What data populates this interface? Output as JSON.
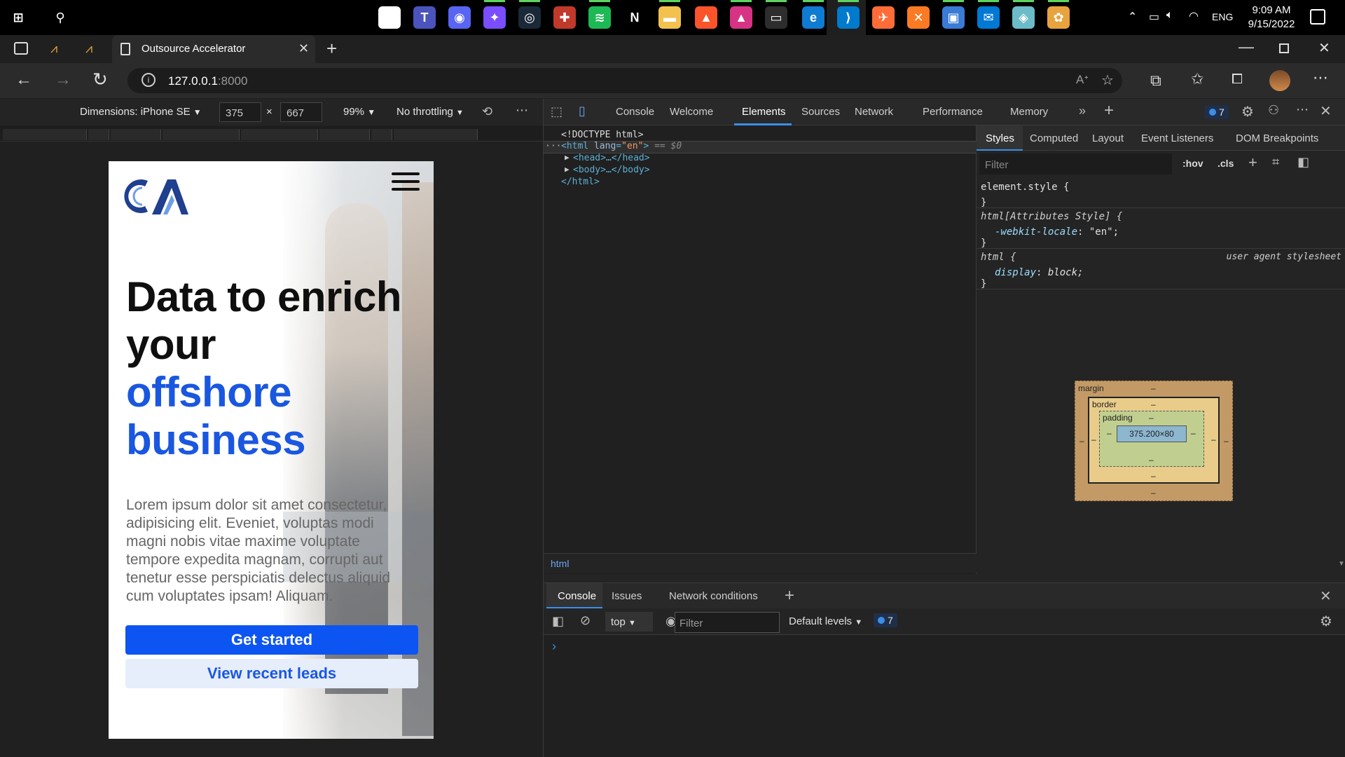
{
  "taskbar": {
    "time": "9:09 AM",
    "date": "9/15/2022",
    "lang": "ENG",
    "apps": [
      {
        "name": "start-icon",
        "glyph": "⊞",
        "color": "#000000"
      },
      {
        "name": "search-icon",
        "glyph": "⚲",
        "color": "#000000"
      },
      {
        "name": "evernote-icon",
        "glyph": "●",
        "color": "#ffffff"
      },
      {
        "name": "teams-icon",
        "glyph": "T",
        "color": "#4b53bc"
      },
      {
        "name": "discord-icon",
        "glyph": "◉",
        "color": "#5865f2"
      },
      {
        "name": "messenger-icon",
        "glyph": "✦",
        "color": "#7a4dff"
      },
      {
        "name": "steam-icon",
        "glyph": "◎",
        "color": "#1b2838"
      },
      {
        "name": "game-app-icon",
        "glyph": "✚",
        "color": "#c0392b"
      },
      {
        "name": "spotify-icon",
        "glyph": "≋",
        "color": "#1db954"
      },
      {
        "name": "netflix-icon",
        "glyph": "N",
        "color": "#000000"
      },
      {
        "name": "file-explorer-icon",
        "glyph": "▬",
        "color": "#f2c14e"
      },
      {
        "name": "brave-icon",
        "glyph": "▲",
        "color": "#fb542b"
      },
      {
        "name": "brave-alt-icon",
        "glyph": "▲",
        "color": "#d63384"
      },
      {
        "name": "terminal-icon",
        "glyph": "▭",
        "color": "#2d2d2d"
      },
      {
        "name": "edge-icon",
        "glyph": "e",
        "color": "#0f7bd1"
      },
      {
        "name": "vscode-icon",
        "glyph": "⟩",
        "color": "#007acc"
      },
      {
        "name": "postman-icon",
        "glyph": "✈",
        "color": "#ff6c37"
      },
      {
        "name": "xampp-icon",
        "glyph": "✕",
        "color": "#fb7a24"
      },
      {
        "name": "photos-icon",
        "glyph": "▣",
        "color": "#3a7bd5"
      },
      {
        "name": "mail-icon",
        "glyph": "✉",
        "color": "#0078d4"
      },
      {
        "name": "app-cube-icon",
        "glyph": "◈",
        "color": "#6bbbc8"
      },
      {
        "name": "paint-icon",
        "glyph": "✿",
        "color": "#e7a33e"
      }
    ]
  },
  "browser": {
    "tab_title": "Outsource Accelerator",
    "url_host": "127.0.0.1",
    "url_port": ":8000"
  },
  "emulation": {
    "dimensions_label": "Dimensions: iPhone SE",
    "width": "375",
    "height": "667",
    "zoom": "99%",
    "throttling": "No throttling"
  },
  "page": {
    "logo_text": "CA",
    "headline_line1": "Data to enrich",
    "headline_line2": "your",
    "headline_line3": "offshore",
    "headline_line4": "business",
    "body": "Lorem ipsum dolor sit amet consectetur, adipisicing elit. Eveniet, voluptas modi magni nobis vitae maxime voluptate tempore expedita magnam, corrupti aut tenetur esse perspiciatis delectus aliquid cum voluptates ipsam! Aliquam.",
    "cta_primary": "Get started",
    "cta_secondary": "View recent leads"
  },
  "devtools": {
    "tabs": [
      "Console",
      "Welcome",
      "Elements",
      "Sources",
      "Network",
      "Performance",
      "Memory"
    ],
    "active_tab": "Elements",
    "issues_count": "7",
    "dom": {
      "doctype": "<!DOCTYPE html>",
      "html_open_tag": "html",
      "html_attr": "lang",
      "html_attr_val": "\"en\"",
      "selected_marker": "== $0",
      "head": "<head>…</head>",
      "body": "<body>…</body>",
      "html_close": "</html>"
    },
    "breadcrumb": "html",
    "styles_tabs": [
      "Styles",
      "Computed",
      "Layout",
      "Event Listeners",
      "DOM Breakpoints"
    ],
    "filter_placeholder": "Filter",
    "hov": ":hov",
    "cls": ".cls",
    "rules": {
      "r1_selector": "element.style {",
      "r1_close": "}",
      "r2_selector": "html[Attributes Style] {",
      "r2_prop": "-webkit-locale",
      "r2_val": "\"en\";",
      "r2_close": "}",
      "r3_selector": "html {",
      "r3_origin": "user agent stylesheet",
      "r3_prop": "display",
      "r3_val": "block;",
      "r3_close": "}"
    },
    "box_model": {
      "margin_label": "margin",
      "border_label": "border",
      "padding_label": "padding",
      "dash": "–",
      "content": "375.200×80"
    },
    "drawer_tabs": [
      "Console",
      "Issues",
      "Network conditions"
    ],
    "drawer_active": "Console",
    "context": "top",
    "console_filter": "Filter",
    "levels": "Default levels",
    "console_count": "7",
    "prompt": "›"
  }
}
